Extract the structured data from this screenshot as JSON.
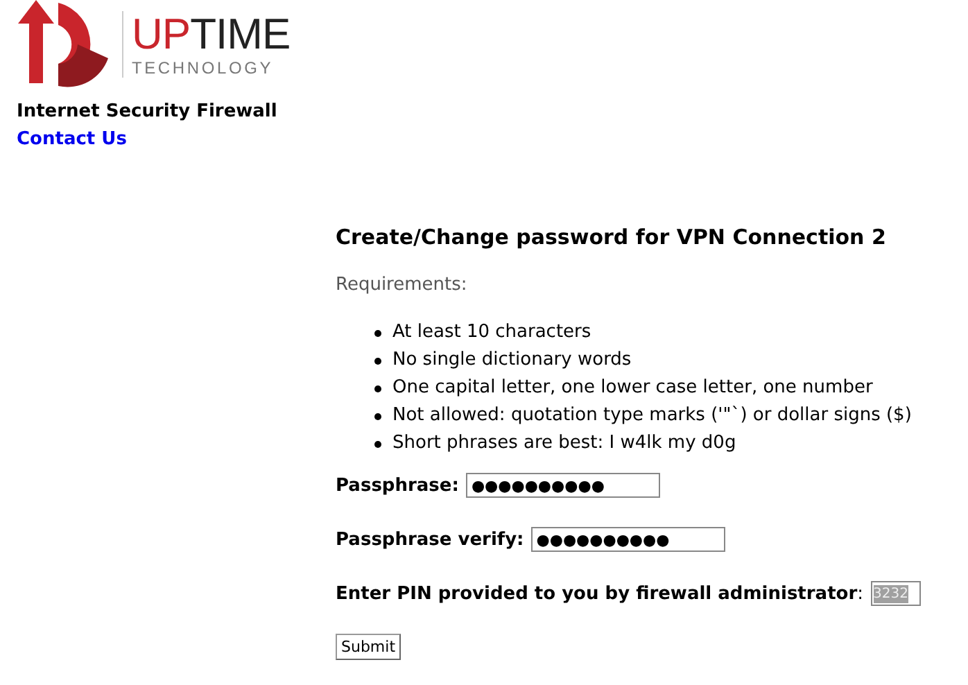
{
  "logo": {
    "brand_part_1": "UP",
    "brand_part_2": "TIME",
    "tagline": "TECHNOLOGY"
  },
  "site_title": "Internet Security Firewall",
  "contact_link": "Contact Us",
  "heading": "Create/Change password for VPN Connection 2",
  "requirements_label": "Requirements:",
  "requirements": [
    "At least 10 characters",
    "No single dictionary words",
    "One capital letter, one lower case letter, one number",
    "Not allowed: quotation type marks ('\"`) or dollar signs ($)",
    "Short phrases are best: I w4lk my d0g"
  ],
  "fields": [
    {
      "label": "Passphrase:",
      "value": "●●●●●●●●●●"
    },
    {
      "label": "Passphrase verify:",
      "value": "●●●●●●●●●●"
    }
  ],
  "pin": {
    "label": "Enter PIN provided to you by firewall administrator",
    "separator": ":",
    "value": "3232"
  },
  "submit": "Submit"
}
